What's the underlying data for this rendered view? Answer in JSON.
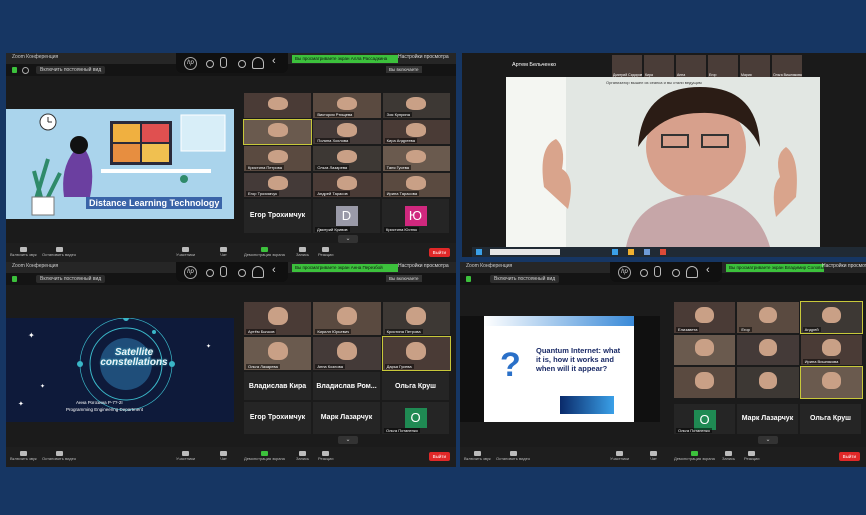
{
  "app_name": "Zoom Конференция",
  "view_label": "Включить постоянный вид",
  "green_banner_1": "Вы просматриваете экран Алла Рассадкинa",
  "green_banner_2": "Вы просматриваете экран Анна Перезбой",
  "green_banner_3": "Вы просматриваете экран Владимир Соловьёв",
  "settings_label": "Настройки просмотра",
  "fullscreen_label": "Вы включаете",
  "hp_label": "hp",
  "q1": {
    "slide_text": "Distance Learning Technology",
    "grid": [
      "",
      "Виктория Ртищева",
      "Зоя Куприна",
      "",
      "Полина Хохлова",
      "Кира Андреева",
      "Кристина Петрова",
      "Ольга Лазарева",
      "Таня Гусева",
      "Егор Трохимчук",
      "Андрей Тарасов",
      "Ирина Тарасова"
    ],
    "names": [
      "Егор Трохимчук"
    ],
    "letters": [
      {
        "letter": "D",
        "color": "#9a9aa8",
        "name": "Дмитрий Кривов"
      },
      {
        "letter": "Ю",
        "color": "#d0287e",
        "name": "Кристина Юстюк"
      }
    ]
  },
  "q2": {
    "host_name": "Артем Бельченко",
    "thumb_names": [
      "Дмитрий Сидоров",
      "Кира",
      "Анна",
      "Егор",
      "Мария",
      "Ольга Вишнякова"
    ],
    "banner": "Организатор вышел из сеанса и вы стали ведущим"
  },
  "q3": {
    "slide_title": "Satellite constellations",
    "slide_author": "Анна Рогозина Р-7?-2І",
    "slide_dept": "Programming Engineering Department",
    "grid": [
      "Артём Бычков",
      "Кирилл Юрьевич",
      "Кристина Петрова",
      "Ольга Лазарева",
      "Анна Козлова",
      "Дарья Гусева"
    ],
    "names": [
      "Владислав Кира",
      "Владислав Ром...",
      "Ольга Круш",
      "Егор Трохимчук",
      "Марк Лазарчук"
    ],
    "letter": {
      "letter": "O",
      "color": "#1f8a53",
      "name": "Ольга Потапенко"
    }
  },
  "q4": {
    "slide_title": "Quantum Internet: what it is, how it works and when will it appear?",
    "grid": [
      "Елизавета",
      "Егор",
      "Андрей",
      "",
      "",
      "Ирина Вишнякова",
      "",
      "",
      "",
      "",
      "Кира Кузнецова",
      "",
      "Кира Лазарева",
      "Таня Иванова",
      "Ольга Миронова"
    ],
    "names": [
      "Марк Лазарчук",
      "Ольга Круш"
    ],
    "letter": {
      "letter": "O",
      "color": "#1f8a53",
      "name": "Ольга Потапенко"
    }
  },
  "controls": [
    "Включить звук",
    "Остановить видео",
    "Участники",
    "Чат",
    "Демонстрация экрана",
    "Запись",
    "Реакции"
  ],
  "end_label": "Выйти"
}
